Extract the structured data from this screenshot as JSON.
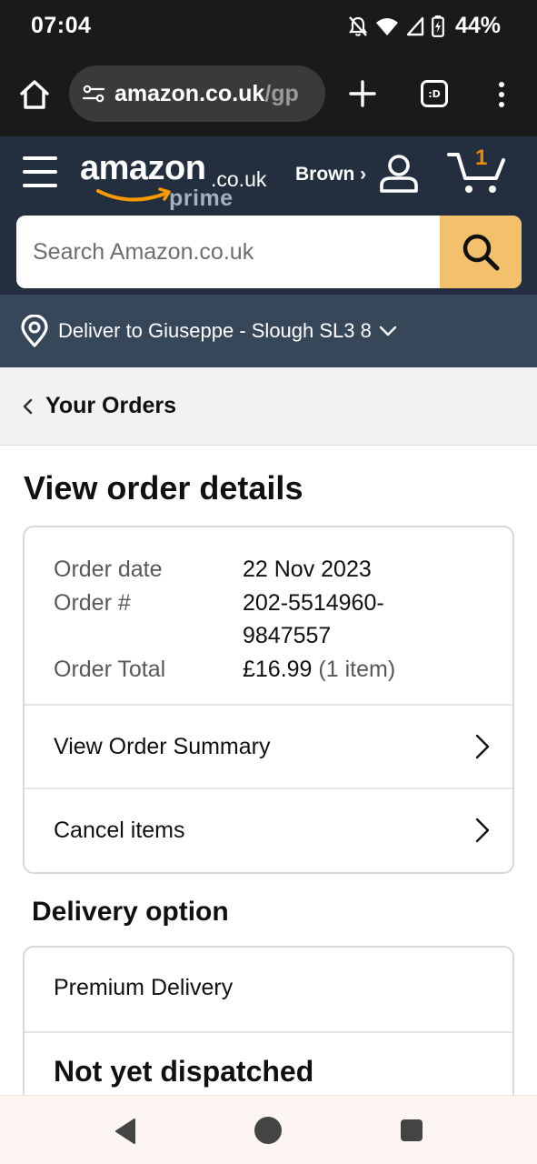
{
  "status_bar": {
    "time": "07:04",
    "battery": "44%",
    "icons": [
      "bell-off-icon",
      "wifi-icon",
      "cell-signal-icon",
      "battery-charging-icon"
    ]
  },
  "browser": {
    "url_domain": "amazon.co.uk",
    "url_path": "/gp",
    "tab_label": ":D",
    "icons": [
      "home-icon",
      "site-settings-icon",
      "plus-icon",
      "tabs-icon",
      "kebab-menu-icon"
    ]
  },
  "header": {
    "logo_word": "amazon",
    "logo_tld": ".co.uk",
    "logo_prime": "prime",
    "account_name": "Brown ›",
    "cart_count": "1",
    "colors": {
      "header_bg": "#232f3e",
      "cart_count": "#f08804",
      "search_button": "#f3c06b"
    }
  },
  "search": {
    "placeholder": "Search Amazon.co.uk",
    "value": ""
  },
  "deliver": {
    "text": "Deliver to Giuseppe - Slough SL3 8"
  },
  "breadcrumb": {
    "label": "Your Orders"
  },
  "page": {
    "title": "View order details"
  },
  "order": {
    "date_label": "Order date",
    "date_value": "22 Nov 2023",
    "number_label": "Order #",
    "number_line1": "202-5514960-",
    "number_line2": "9847557",
    "total_label": "Order Total",
    "total_value": "£16.99",
    "total_items": "(1 item)",
    "links": [
      {
        "label": "View Order Summary"
      },
      {
        "label": "Cancel items"
      }
    ]
  },
  "delivery": {
    "section_title": "Delivery option",
    "method": "Premium Delivery",
    "status": "Not yet dispatched"
  }
}
